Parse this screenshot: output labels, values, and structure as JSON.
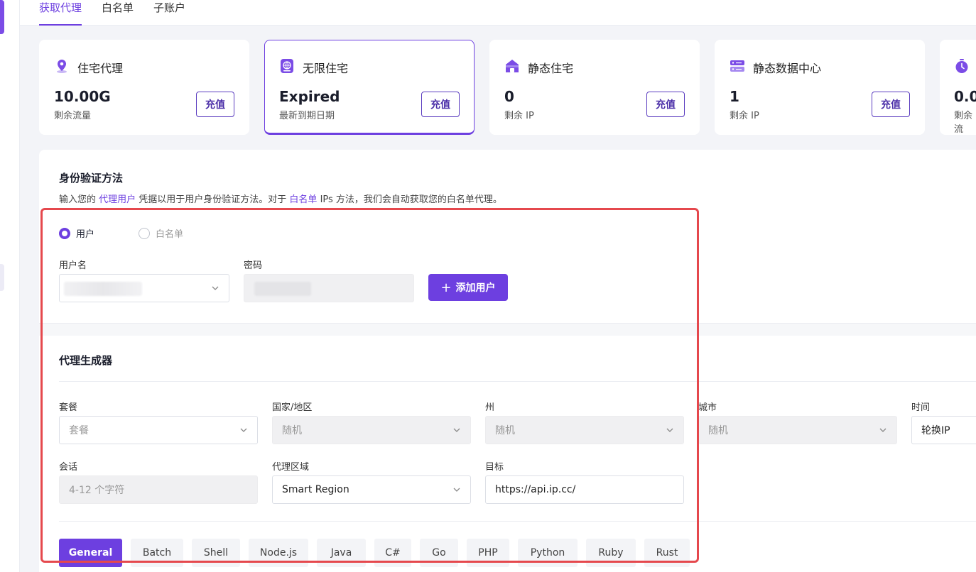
{
  "tabs": [
    "获取代理",
    "白名单",
    "子账户"
  ],
  "cards": [
    {
      "title": "住宅代理",
      "value": "10.00G",
      "sub": "剩余流量",
      "button": "充值",
      "icon": "location-pin-icon"
    },
    {
      "title": "无限住宅",
      "value": "Expired",
      "sub": "最新到期日期",
      "button": "充值",
      "icon": "globe-badge-icon"
    },
    {
      "title": "静态住宅",
      "value": "0",
      "sub": "剩余 IP",
      "button": "充值",
      "icon": "house-icon"
    },
    {
      "title": "静态数据中心",
      "value": "1",
      "sub": "剩余 IP",
      "button": "充值",
      "icon": "server-icon"
    },
    {
      "title": "",
      "value": "0.0",
      "sub": "剩余流",
      "button": "",
      "icon": "timer-icon"
    }
  ],
  "auth": {
    "title": "身份验证方法",
    "desc_1": "输入您的 ",
    "desc_link_1": "代理用户",
    "desc_2": " 凭据以用于用户身份验证方法。对于 ",
    "desc_link_2": "白名单",
    "desc_3": " IPs 方法，我们会自动获取您的白名单代理。",
    "radio_user": "用户",
    "radio_whitelist": "白名单",
    "username_label": "用户名",
    "password_label": "密码",
    "add_user_button": "添加用户"
  },
  "generator": {
    "title": "代理生成器",
    "package_label": "套餐",
    "package_placeholder": "套餐",
    "country_label": "国家/地区",
    "country_value": "随机",
    "state_label": "州",
    "state_value": "随机",
    "city_label": "城市",
    "city_value": "随机",
    "time_label": "时间",
    "time_value": "轮换IP",
    "session_label": "会话",
    "session_placeholder": "4-12 个字符",
    "region_label": "代理区域",
    "region_value": "Smart Region",
    "target_label": "目标",
    "target_value": "https://api.ip.cc/"
  },
  "languages": [
    "General",
    "Batch",
    "Shell",
    "Node.js",
    "Java",
    "C#",
    "Go",
    "PHP",
    "Python",
    "Ruby",
    "Rust"
  ],
  "colors": {
    "accent": "#6d3fe0",
    "highlight_box": "#e5484d"
  }
}
